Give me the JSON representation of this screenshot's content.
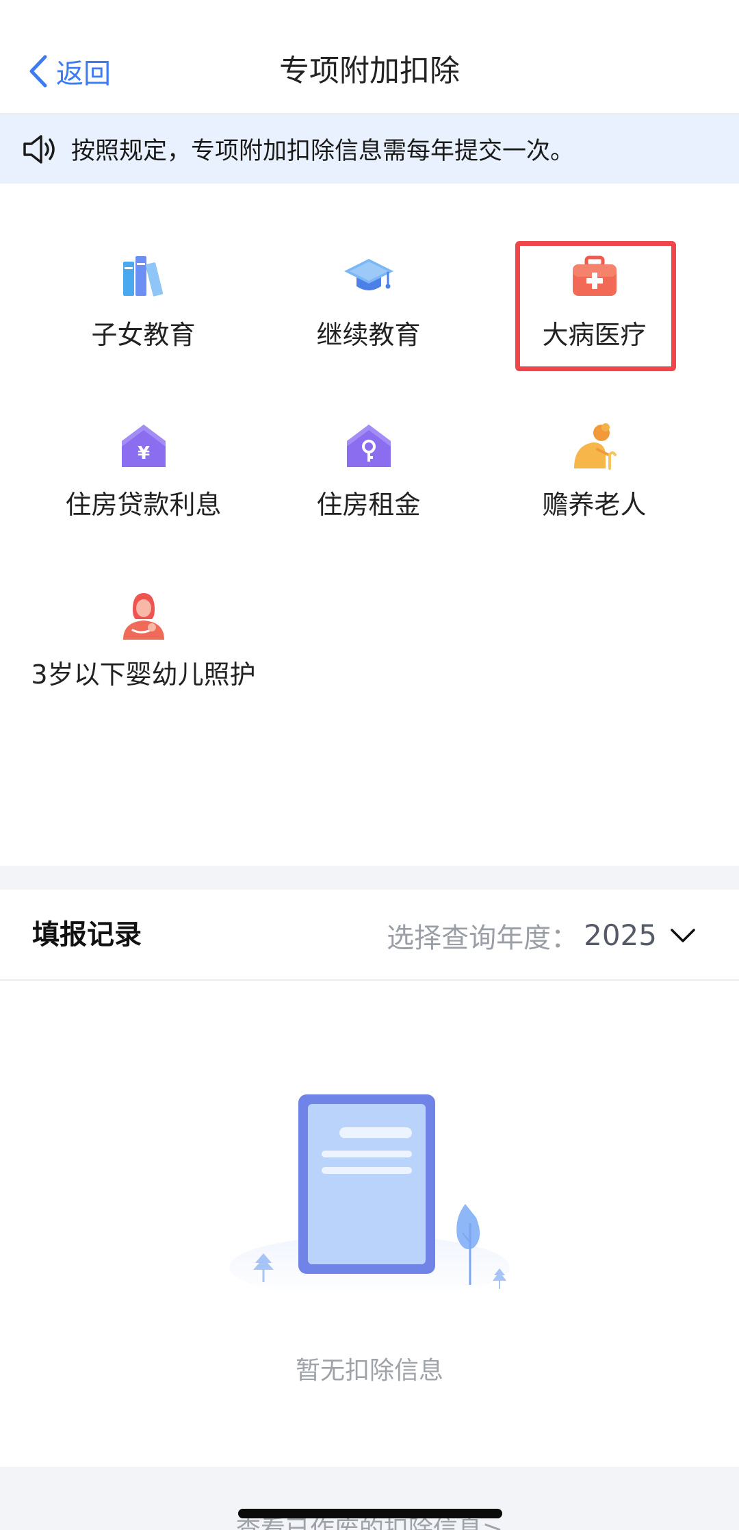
{
  "header": {
    "back_label": "返回",
    "title": "专项附加扣除"
  },
  "notice": {
    "text": "按照规定，专项附加扣除信息需每年提交一次。",
    "icon": "speaker-icon"
  },
  "categories": [
    {
      "label": "子女教育",
      "icon": "books-icon"
    },
    {
      "label": "继续教育",
      "icon": "graduation-cap-icon"
    },
    {
      "label": "大病医疗",
      "icon": "medical-kit-icon",
      "highlighted": true
    },
    {
      "label": "住房贷款利息",
      "icon": "house-yuan-icon"
    },
    {
      "label": "住房租金",
      "icon": "house-key-icon"
    },
    {
      "label": "赡养老人",
      "icon": "elderly-person-icon"
    },
    {
      "label": "3岁以下婴幼儿照护",
      "icon": "mother-baby-icon"
    }
  ],
  "records": {
    "title": "填报记录",
    "year_label": "选择查询年度：",
    "year_value": "2025"
  },
  "empty_state": {
    "text": "暂无扣除信息"
  },
  "footer": {
    "more_link": "查看已作废的扣除信息>"
  },
  "colors": {
    "accent": "#3d7bf0",
    "highlight": "#f0454a",
    "notice_bg": "#e8f1fd"
  }
}
